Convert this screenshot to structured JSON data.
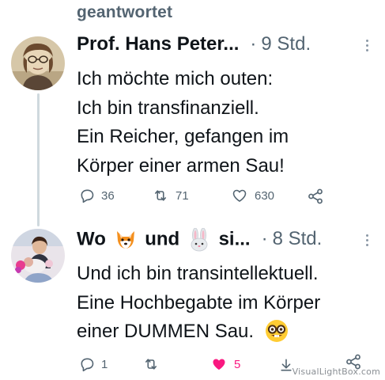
{
  "context_label": "geantwortet",
  "tweets": [
    {
      "author": "Prof. Hans Peter...",
      "separator": "·",
      "time": "9 Std.",
      "lines": [
        "Ich möchte mich outen:",
        "Ich bin transfinanziell.",
        "Ein Reicher, gefangen im",
        "Körper einer armen Sau!"
      ],
      "actions": {
        "reply_count": "36",
        "retweet_count": "71",
        "like_count": "630"
      }
    },
    {
      "author_part1": "Wo",
      "author_part2": "und",
      "author_part3": "si...",
      "author_emojis": [
        "fox-emoji",
        "rabbit-emoji"
      ],
      "separator": "·",
      "time": "8 Std.",
      "lines": [
        "Und ich bin transintellektuell.",
        "Eine Hochbegabte im Körper",
        "einer DUMMEN Sau."
      ],
      "line_emoji": "nerd-face-emoji",
      "actions": {
        "reply_count": "1",
        "retweet_count": "",
        "like_count": "5",
        "like_active": true
      }
    }
  ],
  "colors": {
    "text": "#0f1419",
    "secondary": "#536471",
    "like_active": "#f91880",
    "thread_line": "#cfd9de"
  },
  "watermark": "VisualLightBox.com"
}
